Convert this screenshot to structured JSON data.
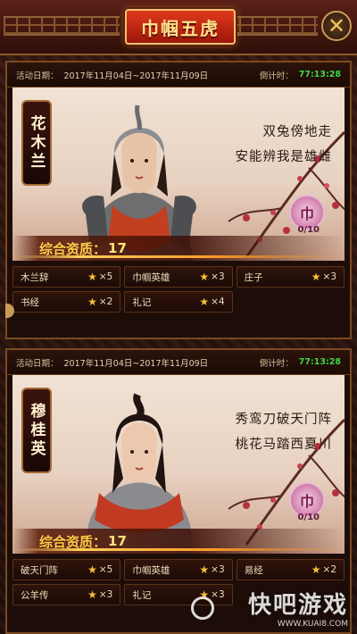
{
  "header": {
    "title": "巾帼五虎",
    "close_label": "✕"
  },
  "cards": [
    {
      "date_label": "活动日期：",
      "dates": "2017年11月04日~2017年11月09日",
      "countdown_label": "倒计时：",
      "countdown": "77:13:28",
      "hero_name": "花木兰",
      "poem_line1": "双兔傍地走",
      "poem_line2": "安能辨我是雄雌",
      "token_glyph": "巾",
      "token_count": "0/10",
      "quality_label": "综合资质：",
      "quality_value": "17",
      "books": [
        {
          "name": "木兰辞",
          "mult": "×5"
        },
        {
          "name": "巾帼英雄",
          "mult": "×3"
        },
        {
          "name": "庄子",
          "mult": "×3"
        },
        {
          "name": "书经",
          "mult": "×2"
        },
        {
          "name": "礼记",
          "mult": "×4"
        }
      ]
    },
    {
      "date_label": "活动日期：",
      "dates": "2017年11月04日~2017年11月09日",
      "countdown_label": "倒计时：",
      "countdown": "77:13:28",
      "hero_name": "穆桂英",
      "poem_line1": "秀鸾刀破天门阵",
      "poem_line2": "桃花马踏西夏川",
      "token_glyph": "巾",
      "token_count": "0/10",
      "quality_label": "综合资质：",
      "quality_value": "17",
      "books": [
        {
          "name": "破天门阵",
          "mult": "×5"
        },
        {
          "name": "巾帼英雄",
          "mult": "×3"
        },
        {
          "name": "易经",
          "mult": "×2"
        },
        {
          "name": "公羊传",
          "mult": "×3"
        },
        {
          "name": "礼记",
          "mult": "×3"
        }
      ]
    }
  ],
  "watermark": {
    "title": "快吧游戏",
    "url": "WWW.KUAI8.COM"
  },
  "colors": {
    "countdown": "#3cd64a",
    "quality": "#ffce4a",
    "star": "#f3c23a",
    "title_plate": "#e03a1c"
  }
}
